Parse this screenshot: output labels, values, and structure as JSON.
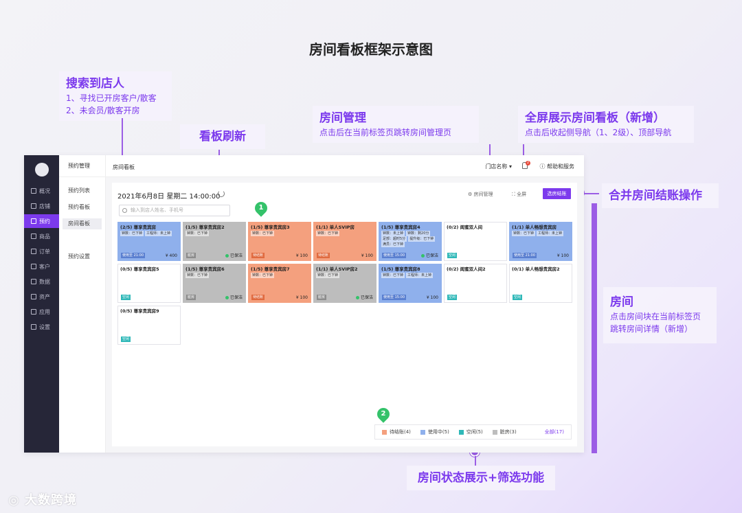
{
  "page": {
    "title": "房间看板框架示意图",
    "watermark": "大数跨境"
  },
  "annotations": {
    "search": {
      "title": "搜索到店人",
      "lines": [
        "1、寻找已开房客户/散客",
        "2、未会员/散客开房"
      ]
    },
    "refresh": {
      "title": "看板刷新"
    },
    "room_mgmt": {
      "title": "房间管理",
      "desc": "点击后在当前标签页跳转房间管理页"
    },
    "fullscreen": {
      "title": "全屏展示房间看板（新增）",
      "desc": "点击后收起侧导航（1、2级）、顶部导航"
    },
    "merge_checkout": {
      "title": "合并房间结账操作"
    },
    "room": {
      "title": "房间",
      "lines": [
        "点击房间块在当前标签页",
        "跳转房间详情（新增）"
      ]
    },
    "status_filter": {
      "title": "房间状态展示+筛选功能"
    }
  },
  "pins": {
    "one": "1",
    "two": "2"
  },
  "nav": {
    "items": [
      {
        "label": "概况",
        "icon": "monitor-icon"
      },
      {
        "label": "店铺",
        "icon": "store-icon"
      },
      {
        "label": "预约",
        "icon": "calendar-icon"
      },
      {
        "label": "商品",
        "icon": "goods-icon"
      },
      {
        "label": "订单",
        "icon": "order-icon"
      },
      {
        "label": "客户",
        "icon": "customer-icon"
      },
      {
        "label": "数据",
        "icon": "chart-icon"
      },
      {
        "label": "资产",
        "icon": "asset-icon"
      },
      {
        "label": "应用",
        "icon": "apps-icon"
      },
      {
        "label": "设置",
        "icon": "gear-icon"
      }
    ],
    "active_index": 2
  },
  "subnav": {
    "header": "预约管理",
    "items": [
      "预约列表",
      "预约看板",
      "房间看板",
      "预约设置"
    ],
    "active_index": 2
  },
  "topbar": {
    "breadcrumb": "房间看板",
    "store": "门店名称 ▾",
    "badge": "2",
    "help": "ⓘ 帮助和服务"
  },
  "toolbar": {
    "date": "2021年6月8日  星期二   14:00:00",
    "room_mgmt": "⚙ 房间管理",
    "fullscreen": "⛶ 全屏",
    "checkout": "选房结账",
    "search_placeholder": "输入到店人姓名、手机号"
  },
  "rooms": [
    {
      "name": "(2/5) 尊享贵宾房",
      "state": "using",
      "tags": [
        "钟数：已下钟",
        "工程师：未上钟"
      ],
      "status": "使用至 21:00",
      "price": "¥ 400"
    },
    {
      "name": "(1/5) 尊享贵宾房2",
      "state": "dirty",
      "tags": [
        "钟数：已下钟"
      ],
      "status": "脏房",
      "cleaned": "已保洁"
    },
    {
      "name": "(1/5) 尊享贵宾房3",
      "state": "pending",
      "tags": [
        "钟数：已下钟"
      ],
      "status": "待结账",
      "price": "¥ 100"
    },
    {
      "name": "(1/1) 单人SVIP房",
      "state": "pending",
      "tags": [
        "钟数：已下钟"
      ],
      "status": "待结账",
      "price": "¥ 100"
    },
    {
      "name": "(1/5) 尊享贵宾房4",
      "state": "using",
      "tags": [
        "钟数：未上钟",
        "钟数：剩20分",
        "足部：超时5分",
        "提升级：已下钟",
        "满员：已下钟"
      ],
      "status": "使用至 15:00",
      "cleaned": "已保洁"
    },
    {
      "name": "(0/2) 闺蜜双人间",
      "state": "free",
      "tags": [],
      "status": "空闲"
    },
    {
      "name": "(1/1) 单人畅想贵宾房",
      "state": "using",
      "tags": [
        "钟数：已下钟",
        "工程师：未上钟"
      ],
      "status": "使用至 21:00",
      "price": "¥ 100"
    },
    {
      "name": "(0/5) 尊享贵宾房5",
      "state": "free",
      "tags": [],
      "status": "空闲"
    },
    {
      "name": "(1/5) 尊享贵宾房6",
      "state": "dirty",
      "tags": [
        "钟数：已下钟"
      ],
      "status": "脏房",
      "cleaned": "已保洁"
    },
    {
      "name": "(1/5) 尊享贵宾房7",
      "state": "pending",
      "tags": [
        "钟数：已下钟"
      ],
      "status": "待结账",
      "price": "¥ 100"
    },
    {
      "name": "(1/1) 单人SVIP房2",
      "state": "dirty",
      "tags": [
        "钟数：已下钟"
      ],
      "status": "脏房",
      "cleaned": "已保洁"
    },
    {
      "name": "(1/5) 尊享贵宾房8",
      "state": "using",
      "tags": [
        "钟数：已下钟",
        "工程师：未上钟"
      ],
      "status": "使用至 15:00",
      "price": "¥ 100"
    },
    {
      "name": "(0/2) 闺蜜双人间2",
      "state": "free",
      "tags": [],
      "status": "空闲"
    },
    {
      "name": "(0/1) 单人畅想贵宾房2",
      "state": "free",
      "tags": [],
      "status": "空闲"
    },
    {
      "name": "(0/5) 尊享贵宾房9",
      "state": "free",
      "tags": [],
      "status": "空闲"
    }
  ],
  "legend": {
    "items": [
      {
        "label": "待结账(4)",
        "color": "#f4a07e"
      },
      {
        "label": "使用中(5)",
        "color": "#8fb0ec"
      },
      {
        "label": "空闲(5)",
        "color": "#2fb8b8"
      },
      {
        "label": "脏房(3)",
        "color": "#bdbdbd"
      }
    ],
    "all": "全部(17)"
  },
  "colors": {
    "accent": "#7c3aed",
    "annotation": "#9b5de5",
    "pin": "#34c26a"
  }
}
